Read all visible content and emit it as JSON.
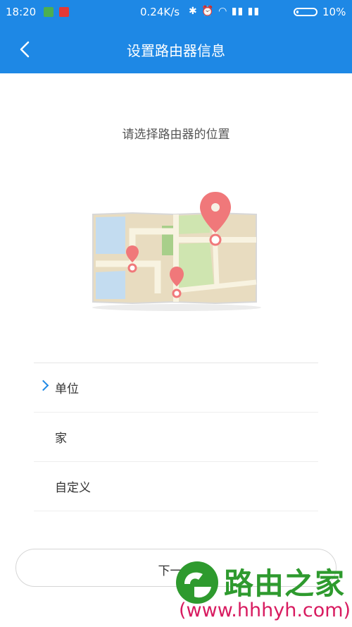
{
  "status_bar": {
    "time": "18:20",
    "net_speed": "0.24K/s",
    "battery_percent": "10%",
    "battery_level": 0.1,
    "icons": [
      "shield-notification-icon",
      "app-notification-icon",
      "bluetooth-icon",
      "alarm-icon",
      "wifi-icon",
      "signal-icon",
      "signal-icon",
      "battery-icon"
    ]
  },
  "header": {
    "title": "设置路由器信息",
    "back_icon": "chevron-left-icon"
  },
  "prompt": "请选择路由器的位置",
  "illustration": {
    "icon": "map-location-illustration",
    "colors": {
      "pin": "#f0787a",
      "park": "#cfe5b0",
      "water": "#c3dcf0",
      "land": "#e8dcc0",
      "road": "#f8f3e1"
    }
  },
  "options": [
    {
      "label": "单位",
      "selected": true
    },
    {
      "label": "家",
      "selected": false
    },
    {
      "label": "自定义",
      "selected": false
    }
  ],
  "next_button": {
    "label": "下一步"
  },
  "watermark": {
    "brand": "路由之家",
    "url": "(www.hhhyh.com)"
  },
  "colors": {
    "accent": "#1e88e5",
    "watermark_green": "#2e9a2e",
    "watermark_pink": "#d81b60"
  }
}
